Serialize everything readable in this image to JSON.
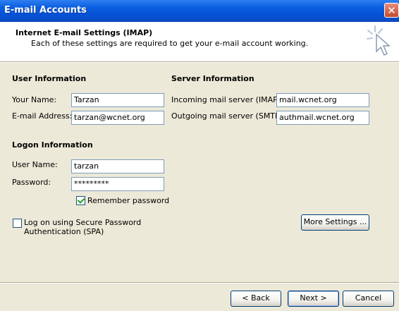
{
  "window": {
    "title": "E-mail Accounts",
    "close_symbol": "✕"
  },
  "header": {
    "title": "Internet E-mail Settings (IMAP)",
    "subtitle": "Each of these settings are required to get your e-mail account working."
  },
  "user_info": {
    "heading": "User Information",
    "name_label": "Your Name:",
    "name_value": "Tarzan",
    "email_label": "E-mail Address:",
    "email_value": "tarzan@wcnet.org"
  },
  "server_info": {
    "heading": "Server Information",
    "incoming_label": "Incoming mail server (IMAP):",
    "incoming_value": "mail.wcnet.org",
    "outgoing_label": "Outgoing mail server (SMTP):",
    "outgoing_value": "authmail.wcnet.org"
  },
  "logon_info": {
    "heading": "Logon Information",
    "username_label": "User Name:",
    "username_value": "tarzan",
    "password_label": "Password:",
    "password_value": "*********",
    "remember_label": "Remember password",
    "remember_checked": true,
    "spa_label_line1": "Log on using Secure Password",
    "spa_label_line2": "Authentication (SPA)",
    "spa_checked": false
  },
  "buttons": {
    "more_settings": "More Settings ...",
    "back": "< Back",
    "next": "Next >",
    "cancel": "Cancel"
  }
}
